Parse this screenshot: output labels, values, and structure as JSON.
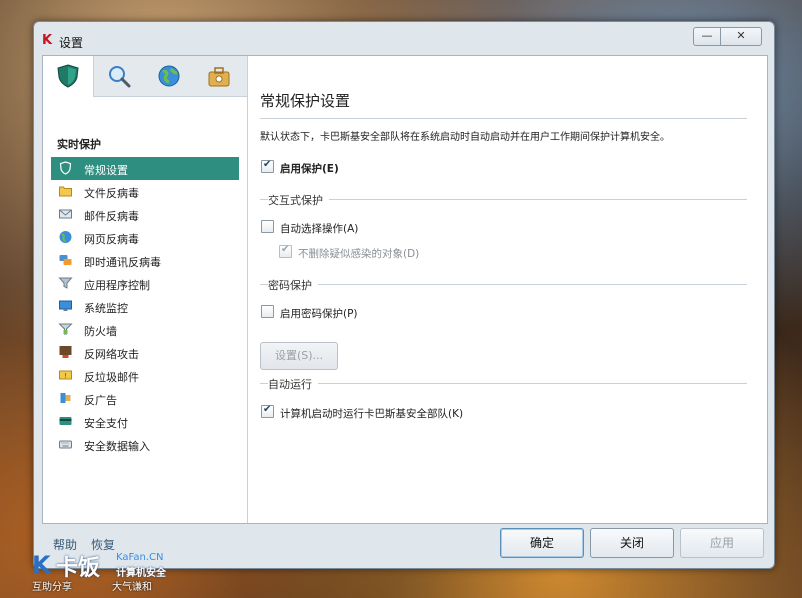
{
  "window": {
    "title": "设置",
    "minimize_glyph": "—",
    "close_glyph": "✕"
  },
  "tabs": [
    {
      "icon": "shield-icon",
      "active": true
    },
    {
      "icon": "magnifier-icon",
      "active": false
    },
    {
      "icon": "globe-icon",
      "active": false
    },
    {
      "icon": "toolbox-icon",
      "active": false
    }
  ],
  "sidebar": {
    "section_title": "实时保护",
    "items": [
      {
        "label": "常规设置",
        "icon": "shield-icon"
      },
      {
        "label": "文件反病毒",
        "icon": "folder-icon"
      },
      {
        "label": "邮件反病毒",
        "icon": "envelope-icon"
      },
      {
        "label": "网页反病毒",
        "icon": "globe-icon"
      },
      {
        "label": "即时通讯反病毒",
        "icon": "chat-icon"
      },
      {
        "label": "应用程序控制",
        "icon": "funnel-icon"
      },
      {
        "label": "系统监控",
        "icon": "monitor-icon"
      },
      {
        "label": "防火墙",
        "icon": "firewall-icon"
      },
      {
        "label": "反网络攻击",
        "icon": "network-attack-icon"
      },
      {
        "label": "反垃圾邮件",
        "icon": "spam-icon"
      },
      {
        "label": "反广告",
        "icon": "anti-banner-icon"
      },
      {
        "label": "安全支付",
        "icon": "payment-card-icon"
      },
      {
        "label": "安全数据输入",
        "icon": "keyboard-icon"
      }
    ]
  },
  "main": {
    "title": "常规保护设置",
    "description": "默认状态下，卡巴斯基安全部队将在系统启动时自动启动并在用户工作期间保护计算机安全。",
    "enable_protection": {
      "label": "启用保护(E)",
      "checked": true
    },
    "interactive_group": "交互式保护",
    "auto_action": {
      "label": "自动选择操作(A)",
      "checked": false
    },
    "dont_delete": {
      "label": "不删除疑似感染的对象(D)",
      "checked": true,
      "disabled": true
    },
    "password_group": "密码保护",
    "enable_password": {
      "label": "启用密码保护(P)",
      "checked": false
    },
    "settings_button": "设置(S)...",
    "autorun_group": "自动运行",
    "autorun": {
      "label": "计算机启动时运行卡巴斯基安全部队(K)",
      "checked": true
    }
  },
  "footer": {
    "help": "帮助",
    "restore": "恢复",
    "ok": "确定",
    "close": "关闭",
    "apply": "应用"
  },
  "watermark": {
    "logo_text": "卡饭",
    "domain": "KaFan.CN",
    "subtitle": "计算机安全",
    "motto_left": "互助分享",
    "motto_right": "大气谦和"
  },
  "colors": {
    "accent": "#2e8f80",
    "brand_red": "#c4161c"
  }
}
